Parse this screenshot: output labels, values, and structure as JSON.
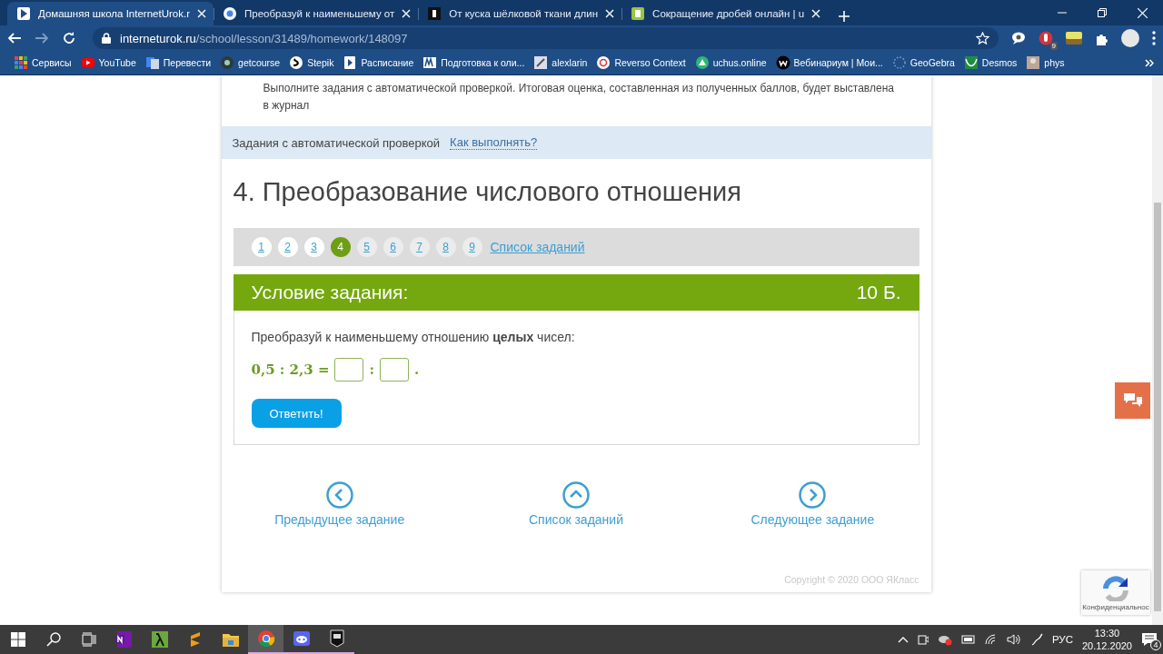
{
  "browser": {
    "tabs": [
      {
        "title": "Домашняя школа InternetUrok.r",
        "selected": true
      },
      {
        "title": "Преобразуй к наименьшему от",
        "selected": false
      },
      {
        "title": "От куска шёлковой ткани длин",
        "selected": false
      },
      {
        "title": "Сокращение дробей онлайн | u",
        "selected": false
      }
    ],
    "url_host": "interneturok.ru",
    "url_path": "/school/lesson/31489/homework/148097",
    "extension_badge": "9",
    "bookmarks": [
      "Сервисы",
      "YouTube",
      "Перевести",
      "getcourse",
      "Stepik",
      "Расписание",
      "Подготовка к оли...",
      "alexlarin",
      "Reverso Context",
      "uchus.online",
      "Вебинариум | Мои...",
      "GeoGebra",
      "Desmos",
      "phys"
    ]
  },
  "page": {
    "intro": "Выполните задания с автоматической проверкой. Итоговая оценка, составленная из полученных баллов, будет выставлена в журнал",
    "info_bar": {
      "label": "Задания с автоматической проверкой",
      "link": "Как выполнять?"
    },
    "heading": "4. Преобразование числового отношения",
    "pagination": [
      {
        "label": "1",
        "selected": false
      },
      {
        "label": "2",
        "selected": false
      },
      {
        "label": "3",
        "selected": false
      },
      {
        "label": "4",
        "selected": true
      },
      {
        "label": "5",
        "selected": false
      },
      {
        "label": "6",
        "selected": false
      },
      {
        "label": "7",
        "selected": false
      },
      {
        "label": "8",
        "selected": false
      },
      {
        "label": "9",
        "selected": false
      }
    ],
    "task_list_link": "Список заданий",
    "task": {
      "title": "Условие задания:",
      "points": "10 Б.",
      "statement": "Преобразуй к наименьшему отношению **целых** чисел:",
      "expression": "0,5 : 2,3 =",
      "separator": ":",
      "end": ".",
      "submit": "Ответить!"
    },
    "nav": [
      {
        "kind": "prev",
        "label": "Предыдущее задание"
      },
      {
        "kind": "list",
        "label": "Список заданий"
      },
      {
        "kind": "next",
        "label": "Следующее задание"
      }
    ],
    "copyright": "Copyright © 2020 ООО ЯКласс",
    "recaptcha_note": "Конфиденциальнос"
  },
  "taskbar": {
    "apps": [
      {
        "kind": "notes",
        "running": false,
        "selected": false
      },
      {
        "kind": "lambda",
        "running": false,
        "selected": false
      },
      {
        "kind": "editor",
        "running": false,
        "selected": false
      },
      {
        "kind": "folder",
        "running": false,
        "selected": false
      },
      {
        "kind": "browser",
        "running": true,
        "selected": true
      },
      {
        "kind": "chat",
        "running": true,
        "selected": false
      },
      {
        "kind": "games",
        "running": true,
        "selected": false
      }
    ],
    "language": "РУС",
    "time": "13:30",
    "date": "20.12.2020",
    "notifications": "4"
  }
}
